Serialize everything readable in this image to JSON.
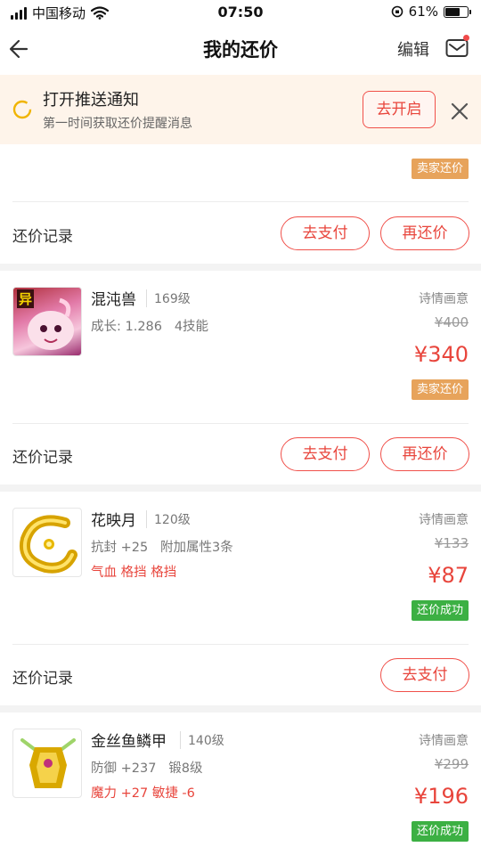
{
  "status_bar": {
    "carrier": "中国移动",
    "time": "07:50",
    "battery": "61%"
  },
  "nav": {
    "title": "我的还价",
    "edit_label": "编辑"
  },
  "push_banner": {
    "title": "打开推送通知",
    "subtitle": "第一时间获取还价提醒消息",
    "button_label": "去开启"
  },
  "first_partial": {
    "badge": "卖家还价",
    "record_label": "还价记录",
    "pay_label": "去支付",
    "recounter_label": "再还价"
  },
  "items": [
    {
      "name": "混沌兽",
      "level": "169级",
      "attrs": "成长: 1.286   4技能",
      "red_attrs": "",
      "server": "诗情画意",
      "old_price": "¥400",
      "new_price": "¥340",
      "badge": "卖家还价",
      "record_label": "还价记录",
      "pay_label": "去支付",
      "recounter_label": "再还价",
      "thumb_text": "异"
    },
    {
      "name": "花映月",
      "level": "120级",
      "attrs": "抗封 +25   附加属性3条",
      "red_attrs": "气血 格挡 格挡",
      "server": "诗情画意",
      "old_price": "¥133",
      "new_price": "¥87",
      "badge": "还价成功",
      "record_label": "还价记录",
      "pay_label": "去支付"
    },
    {
      "name": "金丝鱼鳞甲",
      "level": "140级",
      "attrs": "防御 +237   锻8级",
      "red_attrs": "魔力 +27 敏捷 -6",
      "server": "诗情画意",
      "old_price": "¥299",
      "new_price": "¥196",
      "badge": "还价成功"
    }
  ],
  "colors": {
    "accent_red": "#e8453c",
    "badge_orange": "#e7a35b",
    "badge_green": "#3cb043",
    "banner_bg": "#fef4ea"
  }
}
